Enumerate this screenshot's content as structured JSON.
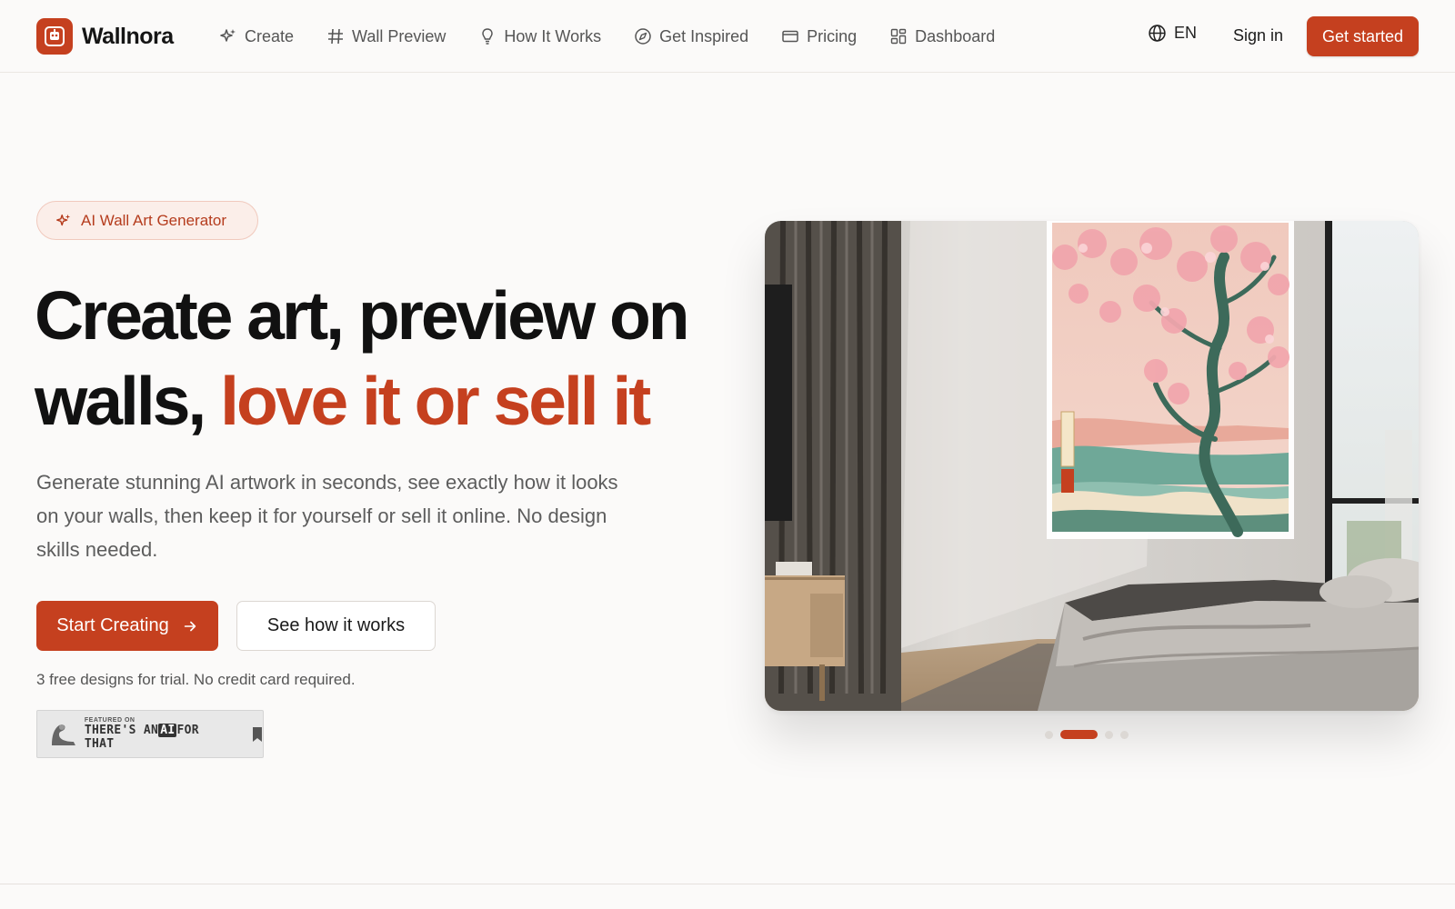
{
  "brand": {
    "name": "Wallnora",
    "accent": "#c5401f"
  },
  "nav": {
    "items": [
      {
        "label": "Create",
        "icon": "sparkles-icon"
      },
      {
        "label": "Wall Preview",
        "icon": "hash-icon"
      },
      {
        "label": "How It Works",
        "icon": "lightbulb-icon"
      },
      {
        "label": "Get Inspired",
        "icon": "compass-icon"
      },
      {
        "label": "Pricing",
        "icon": "credit-card-icon"
      },
      {
        "label": "Dashboard",
        "icon": "dashboard-grid-icon"
      }
    ],
    "language": "EN",
    "sign_in": "Sign in",
    "get_started": "Get started"
  },
  "hero": {
    "badge": "AI Wall Art Generator",
    "headline_part1": "Create art, preview on walls, ",
    "headline_accent": "love it or sell it",
    "subtext": "Generate stunning AI artwork in seconds, see exactly how it looks on your walls, then keep it for yourself or sell it online. No design skills needed.",
    "primary_cta": "Start Creating",
    "secondary_cta": "See how it works",
    "note": "3 free designs for trial. No credit card required.",
    "featured_small": "FEATURED ON",
    "featured_big_1": "THERE'S AN",
    "featured_big_ai": "AI",
    "featured_big_2": "FOR THAT"
  },
  "carousel": {
    "slide_count": 4,
    "active_index": 1
  }
}
